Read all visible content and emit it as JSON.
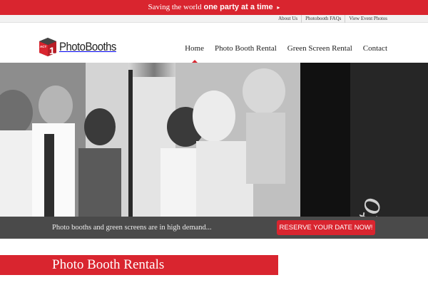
{
  "topbar": {
    "text_regular": "Saving the world",
    "text_bold": "one party at a time",
    "arrow": "▸"
  },
  "utility_links": [
    {
      "label": "About Us"
    },
    {
      "label": "Photobooth FAQs"
    },
    {
      "label": "View Event Photos"
    }
  ],
  "logo": {
    "badge_text": "ACT",
    "badge_number": "1",
    "wordmark": "PhotoBooths"
  },
  "nav": [
    {
      "label": "Home",
      "active": true
    },
    {
      "label": "Photo Booth Rental",
      "active": false
    },
    {
      "label": "Green Screen Rental",
      "active": false
    },
    {
      "label": "Contact",
      "active": false
    }
  ],
  "hero": {
    "sign_text": "Photo"
  },
  "cta": {
    "text": "Photo booths and green screens are in high demand...",
    "button_label": "RESERVE YOUR DATE NOW!"
  },
  "section": {
    "title": "Photo Booth Rentals"
  },
  "colors": {
    "accent": "#d9252f",
    "cta_bar": "#4a4a4a"
  }
}
